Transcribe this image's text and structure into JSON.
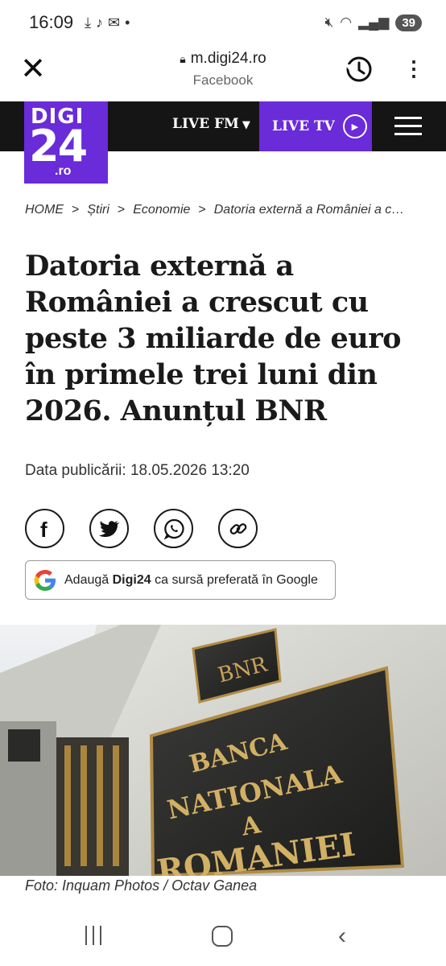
{
  "status": {
    "time": "16:09",
    "battery": "39"
  },
  "browser": {
    "url": "m.digi24.ro",
    "subtitle": "Facebook"
  },
  "site": {
    "logo_top": "DIGI",
    "logo_num": "24",
    "logo_tld": ".ro",
    "live_fm": "LIVE FM",
    "live_tv": "LIVE TV"
  },
  "breadcrumb": {
    "items": [
      "HOME",
      "Știri",
      "Economie",
      "Datoria externă a României a c…"
    ],
    "separator": ">"
  },
  "article": {
    "title": "Datoria externă a României a crescut cu peste 3 miliarde de euro în primele trei luni din 2026. Anunțul BNR",
    "date_label": "Data publicării:",
    "date_value": "18.05.2026 13:20",
    "google_pref_pre": "Adaugă",
    "google_pref_brand": "Digi24",
    "google_pref_post": "ca sursă preferată în Google",
    "image_sign_line1": "BANCA",
    "image_sign_line2": "NATIONALA",
    "image_sign_line3": "A",
    "image_sign_line4": "ROMANIEI",
    "caption": "Foto: Inquam Photos / Octav Ganea"
  },
  "share_icons": [
    "facebook-icon",
    "twitter-icon",
    "whatsapp-icon",
    "link-icon"
  ],
  "colors": {
    "brand_purple": "#6a2bd9",
    "nav_dark": "#151515"
  }
}
